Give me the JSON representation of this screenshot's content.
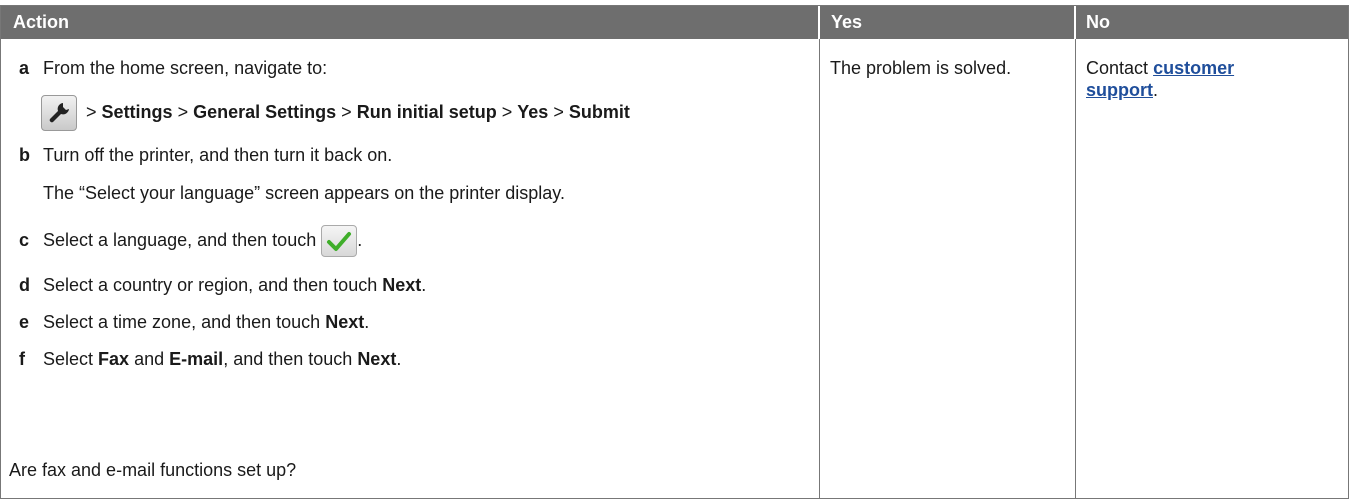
{
  "table": {
    "headers": {
      "action": "Action",
      "yes": "Yes",
      "no": "No"
    },
    "steps": {
      "a": {
        "letter": "a",
        "text": "From the home screen, navigate to:"
      },
      "path": {
        "sep": ">",
        "settings": "Settings",
        "general": "General Settings",
        "run": "Run initial setup",
        "yes": "Yes",
        "submit": "Submit"
      },
      "b": {
        "letter": "b",
        "text": "Turn off the printer, and then turn it back on.",
        "note": "The “Select your language” screen appears on the printer display."
      },
      "c": {
        "letter": "c",
        "text": "Select a language, and then touch",
        "end": "."
      },
      "d": {
        "letter": "d",
        "text": "Select a country or region, and then touch",
        "bold": "Next",
        "end": "."
      },
      "e": {
        "letter": "e",
        "text": "Select a time zone, and then touch",
        "bold": "Next",
        "end": "."
      },
      "f": {
        "letter": "f",
        "pre": "Select",
        "bold1": "Fax",
        "mid": "and",
        "bold2": "E-mail",
        "post": ", and then touch",
        "bold3": "Next",
        "end": "."
      }
    },
    "question": "Are fax and e-mail functions set up?",
    "yes_cell": "The problem is solved.",
    "no_cell": {
      "prefix": "Contact",
      "link_line1": "customer",
      "link_line2": "support",
      "end": "."
    }
  }
}
